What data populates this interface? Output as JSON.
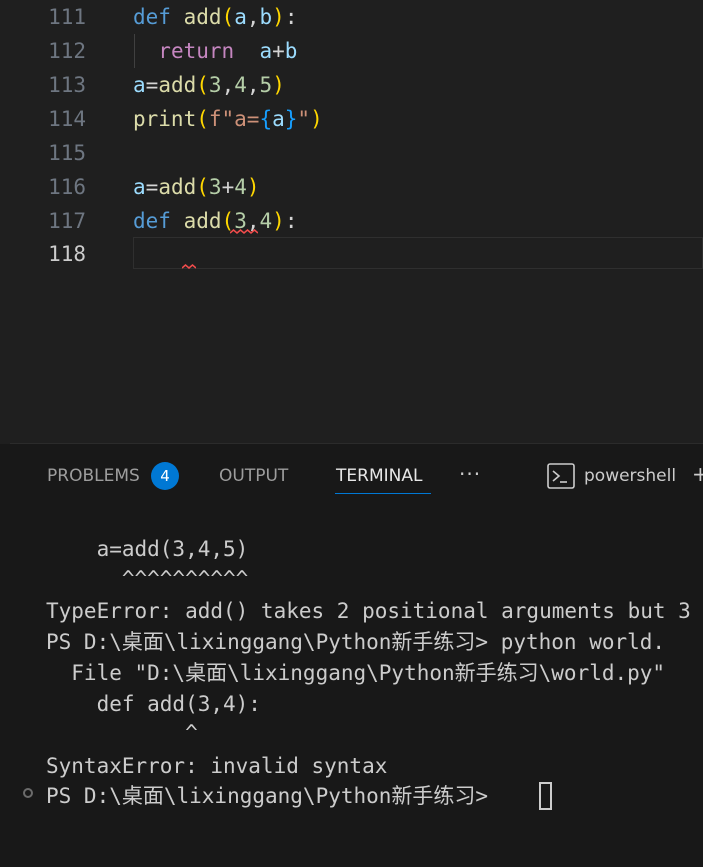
{
  "editor": {
    "line_numbers": [
      "111",
      "112",
      "113",
      "114",
      "115",
      "116",
      "117",
      "118"
    ],
    "active_line": "118",
    "lines": [
      [
        {
          "t": "def",
          "c": "kw"
        },
        {
          "t": " ",
          "c": ""
        },
        {
          "t": "add",
          "c": "fn"
        },
        {
          "t": "(",
          "c": "p1"
        },
        {
          "t": "a",
          "c": "var"
        },
        {
          "t": ",",
          "c": "op"
        },
        {
          "t": "b",
          "c": "var"
        },
        {
          "t": ")",
          "c": "p1"
        },
        {
          "t": ":",
          "c": "op"
        }
      ],
      [
        {
          "t": "  ",
          "c": ""
        },
        {
          "t": "return",
          "c": "kw2"
        },
        {
          "t": "  ",
          "c": ""
        },
        {
          "t": "a",
          "c": "var"
        },
        {
          "t": "+",
          "c": "op"
        },
        {
          "t": "b",
          "c": "var"
        }
      ],
      [
        {
          "t": "a",
          "c": "var"
        },
        {
          "t": "=",
          "c": "op"
        },
        {
          "t": "add",
          "c": "fn"
        },
        {
          "t": "(",
          "c": "p1"
        },
        {
          "t": "3",
          "c": "num"
        },
        {
          "t": ",",
          "c": "op"
        },
        {
          "t": "4",
          "c": "num"
        },
        {
          "t": ",",
          "c": "op"
        },
        {
          "t": "5",
          "c": "num"
        },
        {
          "t": ")",
          "c": "p1"
        }
      ],
      [
        {
          "t": "print",
          "c": "fn"
        },
        {
          "t": "(",
          "c": "p1"
        },
        {
          "t": "f\"a=",
          "c": "str"
        },
        {
          "t": "{",
          "c": "p3"
        },
        {
          "t": "a",
          "c": "var"
        },
        {
          "t": "}",
          "c": "p3"
        },
        {
          "t": "\"",
          "c": "str"
        },
        {
          "t": ")",
          "c": "p1"
        }
      ],
      [],
      [
        {
          "t": "a",
          "c": "var"
        },
        {
          "t": "=",
          "c": "op"
        },
        {
          "t": "add",
          "c": "fn"
        },
        {
          "t": "(",
          "c": "p1"
        },
        {
          "t": "3",
          "c": "num"
        },
        {
          "t": "+",
          "c": "op"
        },
        {
          "t": "4",
          "c": "num"
        },
        {
          "t": ")",
          "c": "p1"
        }
      ],
      [
        {
          "t": "def",
          "c": "kw"
        },
        {
          "t": " ",
          "c": ""
        },
        {
          "t": "add",
          "c": "fn"
        },
        {
          "t": "(",
          "c": "p1"
        },
        {
          "t": "3",
          "c": "num"
        },
        {
          "t": ",",
          "c": "op"
        },
        {
          "t": "4",
          "c": "num"
        },
        {
          "t": ")",
          "c": "p1"
        },
        {
          "t": ":",
          "c": "op"
        }
      ],
      []
    ]
  },
  "panel": {
    "tabs": {
      "problems": "PROBLEMS",
      "problems_count": "4",
      "output": "OUTPUT",
      "terminal": "TERMINAL",
      "more": "···",
      "shell_name": "powershell",
      "plus": "+"
    },
    "terminal_lines": [
      "    a=add(3,4,5)",
      "      ^^^^^^^^^^",
      "TypeError: add() takes 2 positional arguments but 3",
      "PS D:\\桌面\\lixinggang\\Python新手练习> python world.",
      "  File \"D:\\桌面\\lixinggang\\Python新手练习\\world.py\"",
      "    def add(3,4):",
      "           ^",
      "SyntaxError: invalid syntax",
      "PS D:\\桌面\\lixinggang\\Python新手练习> "
    ]
  },
  "colors": {
    "editor_bg": "#1f1f1f",
    "panel_bg": "#181818",
    "accent": "#0078d4",
    "error_squiggle": "#f14c4c"
  }
}
